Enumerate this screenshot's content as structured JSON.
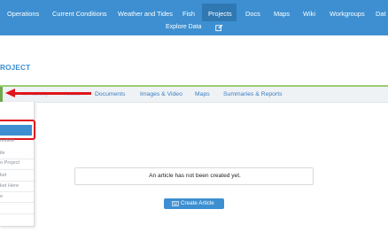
{
  "nav": {
    "items": [
      {
        "label": "Operations"
      },
      {
        "label": "Current Conditions"
      },
      {
        "label": "Weather and Tides"
      },
      {
        "label": "Fish"
      },
      {
        "label": "Projects",
        "active": true
      },
      {
        "label": "Docs"
      },
      {
        "label": "Maps"
      },
      {
        "label": "Wiki"
      },
      {
        "label": "Workgroups"
      },
      {
        "label": "Dat"
      }
    ],
    "explore_label": "Explore Data",
    "edit_icon": "edit-icon"
  },
  "page": {
    "title": "ROJECT"
  },
  "tabs": [
    {
      "label": "st Activity"
    },
    {
      "label": "Article"
    },
    {
      "label": "Documents"
    },
    {
      "label": "Images & Video"
    },
    {
      "label": "Maps"
    },
    {
      "label": "Summaries & Reports"
    }
  ],
  "dropdown": {
    "items": [
      {
        "label": ""
      },
      {
        "label": "review"
      },
      {
        "label": "ile"
      },
      {
        "label": "o Project"
      },
      {
        "label": "ket"
      },
      {
        "label": "ket Here"
      },
      {
        "label": "e"
      },
      {
        "label": ""
      }
    ]
  },
  "empty_state": {
    "message": "An article has not been created yet."
  },
  "create_button": {
    "label": "Create Article"
  },
  "colors": {
    "nav_bg": "#3d8fd1",
    "nav_active_bg": "#2f78b2",
    "link": "#3b7cc0",
    "annotation_red": "#e1151c",
    "tab_top_border": "#9acd72"
  }
}
